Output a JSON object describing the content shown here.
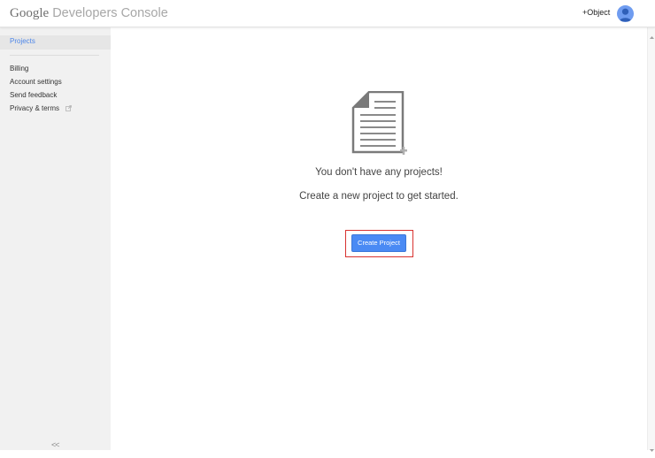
{
  "header": {
    "brand_google": "Google",
    "brand_product": "Developers Console",
    "plus_user": "+Object",
    "avatar_icon": "user-avatar-icon",
    "colors": {
      "brand_gray": "#6f6f6f",
      "avatar": "#6f9cf0"
    }
  },
  "sidebar": {
    "selected": "Projects",
    "items": [
      {
        "label": "Billing"
      },
      {
        "label": "Account settings"
      },
      {
        "label": "Send feedback"
      },
      {
        "label": "Privacy & terms",
        "icon": "external-link-icon"
      }
    ],
    "collapse_label": "<<",
    "colors": {
      "background": "#f1f1f1",
      "selected_text": "#4d86e8"
    }
  },
  "main": {
    "empty_icon": "document-add-icon",
    "empty_title": "You don't have any projects!",
    "empty_subtitle": "Create a new project to get started.",
    "create_button_label": "Create Project",
    "colors": {
      "button": "#4a8af4",
      "highlight_border": "#d8322f"
    }
  }
}
